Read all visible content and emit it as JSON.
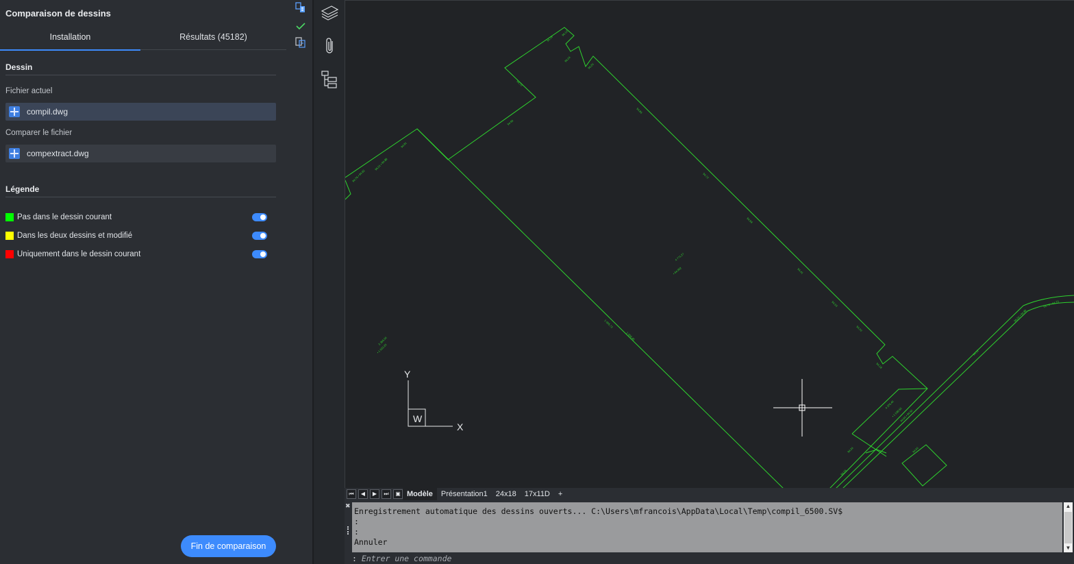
{
  "panel": {
    "title": "Comparaison de dessins",
    "tabs": [
      {
        "label": "Installation",
        "active": true
      },
      {
        "label": "Résultats (45182)",
        "active": false
      }
    ],
    "drawing_section": "Dessin",
    "current_file_label": "Fichier actuel",
    "current_file": "compil.dwg",
    "compare_file_label": "Comparer le fichier",
    "compare_file": "compextract.dwg",
    "legend_section": "Légende",
    "legend": [
      {
        "label": "Pas dans le dessin courant",
        "color": "#00ff00",
        "enabled": true
      },
      {
        "label": "Dans les deux dessins et modifié",
        "color": "#ffff00",
        "enabled": true
      },
      {
        "label": "Uniquement dans le dessin courant",
        "color": "#ff0000",
        "enabled": true
      }
    ],
    "end_button": "Fin de comparaison"
  },
  "side_icons": [
    "compare-files-icon",
    "checkmark-icon",
    "compare-list-icon"
  ],
  "tool_icons": [
    "layers-icon",
    "attach-icon",
    "structure-tree-icon"
  ],
  "ucs": {
    "x_label": "X",
    "y_label": "Y",
    "w_label": "W"
  },
  "layout_tabs": {
    "nav": [
      "first-layout",
      "previous-layout",
      "next-layout",
      "last-layout",
      "layout-menu"
    ],
    "tabs": [
      {
        "label": "Modèle",
        "active": true
      },
      {
        "label": "Présentation1",
        "active": false
      },
      {
        "label": "24x18",
        "active": false
      },
      {
        "label": "17x11D",
        "active": false
      }
    ],
    "add_label": "+"
  },
  "command": {
    "history": [
      "Enregistrement automatique des dessins ouverts... C:\\Users\\mfrancois\\AppData\\Local\\Temp\\compil_6500.SV$",
      ":",
      ":",
      "Annuler"
    ],
    "prompt": ":",
    "placeholder": "Entrer une commande"
  },
  "colors": {
    "accent": "#3d8bfd",
    "drawing_lines": "#2ed32e",
    "canvas_bg": "#212326",
    "panel_bg": "#2b2e33"
  }
}
